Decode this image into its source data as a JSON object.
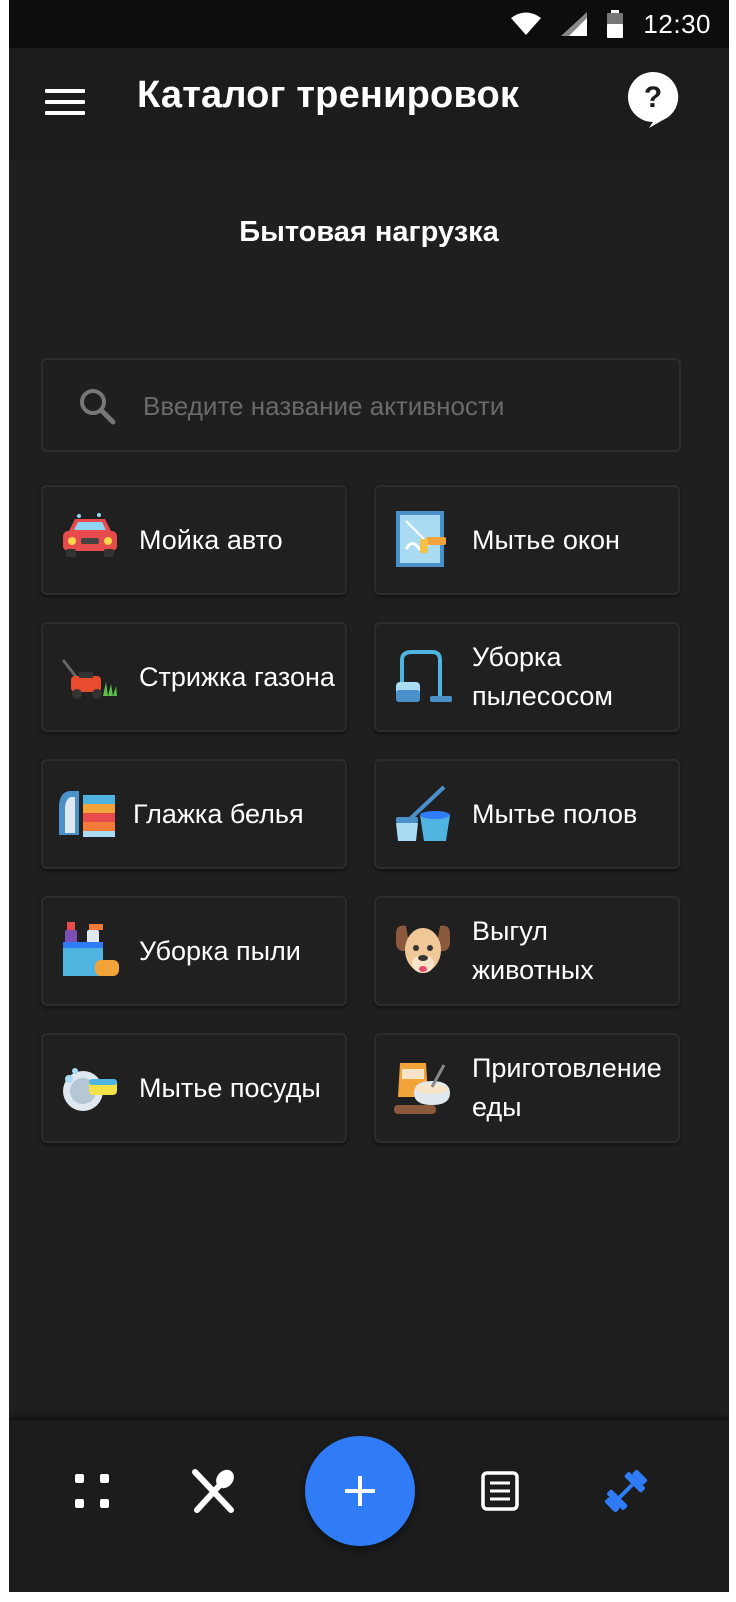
{
  "status_bar": {
    "time": "12:30"
  },
  "app_bar": {
    "title": "Каталог тренировок"
  },
  "section": {
    "title": "Бытовая нагрузка"
  },
  "search": {
    "placeholder": "Введите название активности"
  },
  "activities": [
    {
      "label": "Мойка авто",
      "icon": "car-wash-icon"
    },
    {
      "label": "Мытье окон",
      "icon": "window-cleaning-icon"
    },
    {
      "label": "Стрижка газона",
      "icon": "lawn-mower-icon"
    },
    {
      "label": "Уборка пылесосом",
      "icon": "vacuum-cleaner-icon"
    },
    {
      "label": "Глажка белья",
      "icon": "ironing-icon"
    },
    {
      "label": "Мытье полов",
      "icon": "mop-icon"
    },
    {
      "label": "Уборка пыли",
      "icon": "dusting-icon"
    },
    {
      "label": "Выгул животных",
      "icon": "dog-icon"
    },
    {
      "label": "Мытье посуды",
      "icon": "dish-washing-icon"
    },
    {
      "label": "Приготовление еды",
      "icon": "cooking-icon"
    }
  ],
  "colors": {
    "accent": "#2f7cf6",
    "background": "#1f1f1f",
    "card": "#202020"
  }
}
